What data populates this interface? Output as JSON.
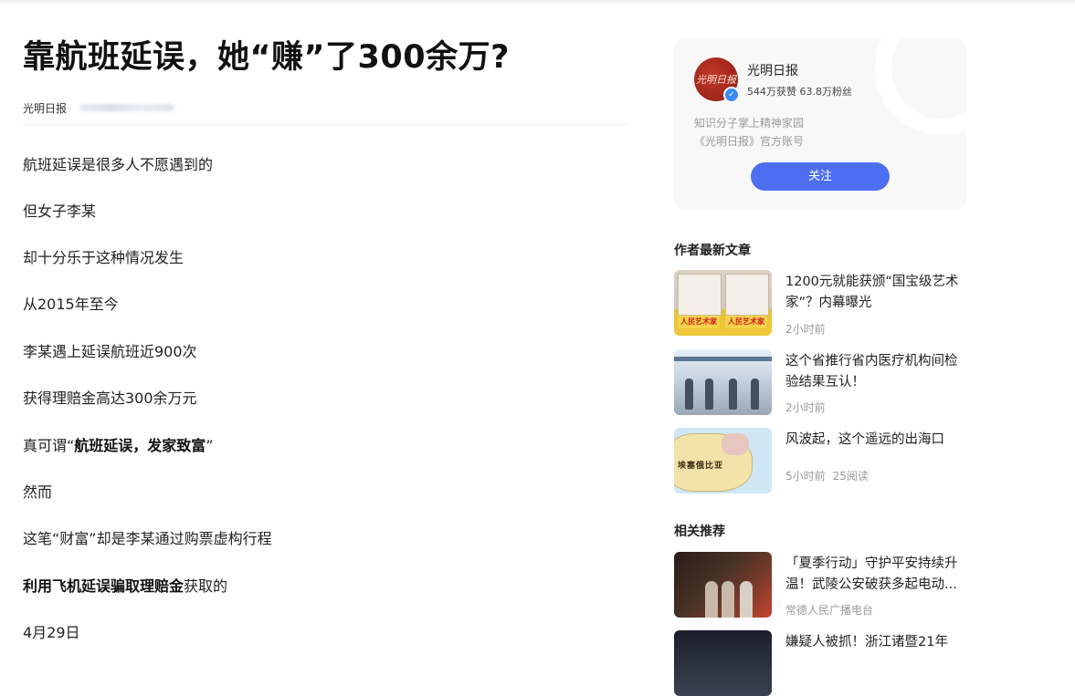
{
  "article": {
    "title": "靠航班延误，她“赚”了300余万?",
    "source": "光明日报",
    "paragraphs": [
      {
        "parts": [
          {
            "t": "航班延误是很多人不愿遇到的",
            "b": false
          }
        ]
      },
      {
        "parts": [
          {
            "t": "但女子李某",
            "b": false
          }
        ]
      },
      {
        "parts": [
          {
            "t": "却十分乐于这种情况发生",
            "b": false
          }
        ]
      },
      {
        "parts": [
          {
            "t": "从2015年至今",
            "b": false
          }
        ]
      },
      {
        "parts": [
          {
            "t": "李某遇上延误航班近900次",
            "b": false
          }
        ]
      },
      {
        "parts": [
          {
            "t": "获得理赔金高达300余万元",
            "b": false
          }
        ]
      },
      {
        "parts": [
          {
            "t": "真可谓“",
            "b": false
          },
          {
            "t": "航班延误，发家致富",
            "b": true
          },
          {
            "t": "”",
            "b": false
          }
        ]
      },
      {
        "parts": [
          {
            "t": "然而",
            "b": false
          }
        ]
      },
      {
        "parts": [
          {
            "t": "这笔“财富”却是李某通过购票虚构行程",
            "b": false
          }
        ]
      },
      {
        "parts": [
          {
            "t": "利用飞机延误骗取理赔金",
            "b": true
          },
          {
            "t": "获取的",
            "b": false
          }
        ]
      },
      {
        "parts": [
          {
            "t": "4月29日",
            "b": false
          }
        ]
      }
    ]
  },
  "author": {
    "avatar_text": "光明日报",
    "name": "光明日报",
    "stats": "544万获赞 63.8万粉丝",
    "bio_line1": "知识分子掌上精神家园",
    "bio_line2": "《光明日报》官方账号",
    "follow_label": "关注"
  },
  "latest": {
    "title": "作者最新文章",
    "items": [
      {
        "title": "1200元就能获颁“国宝级艺术家”？内幕曝光",
        "time": "2小时前",
        "reads": "",
        "thumb_labels": [
          "人民艺术家",
          "人民艺术家"
        ]
      },
      {
        "title": "这个省推行省内医疗机构间检验结果互认！",
        "time": "2小时前",
        "reads": ""
      },
      {
        "title": "风波起，这个遥远的出海口",
        "time": "5小时前",
        "reads": "25阅读",
        "thumb_label": "埃塞俄比亚"
      }
    ]
  },
  "related": {
    "title": "相关推荐",
    "items": [
      {
        "title": "「夏季行动」守护平安持续升温！武陵公安破获多起电动...",
        "source": "常德人民广播电台"
      },
      {
        "title": "嫌疑人被抓！浙江诸暨21年",
        "source": ""
      }
    ]
  },
  "colors": {
    "accent": "#4e6ef2",
    "avatar": "#b2241a",
    "muted": "#999999"
  }
}
